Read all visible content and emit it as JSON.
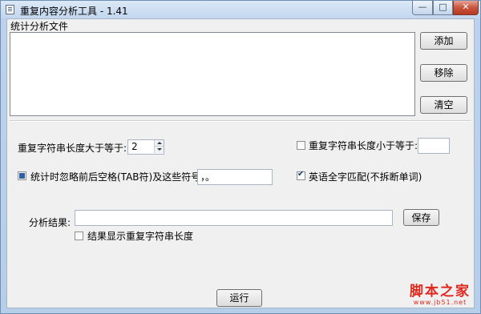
{
  "window": {
    "title": "重复内容分析工具 - 1.41",
    "controls": {
      "minimize": "—",
      "maximize": "□",
      "close": "✕"
    }
  },
  "files": {
    "group_label": "统计分析文件",
    "items": [],
    "add_label": "添加",
    "remove_label": "移除",
    "clear_label": "清空"
  },
  "options": {
    "min_length_label": "重复字符串长度大于等于:",
    "min_length_value": "2",
    "max_length_label": "重复字符串长度小于等于:",
    "max_length_checked": false,
    "max_length_value": "",
    "ignore_label": "统计时忽略前后空格(TAB符)及这些符号:",
    "ignore_checked": true,
    "ignore_symbols": "，。",
    "english_label": "英语全字匹配(不拆断单词)",
    "english_checked": true
  },
  "result": {
    "label": "分析结果:",
    "path_value": "",
    "save_label": "保存",
    "show_length_label": "结果显示重复字符串长度",
    "show_length_checked": false
  },
  "run_label": "运行",
  "watermark": {
    "main": "脚本之家",
    "sub": "www.jb51.net"
  }
}
